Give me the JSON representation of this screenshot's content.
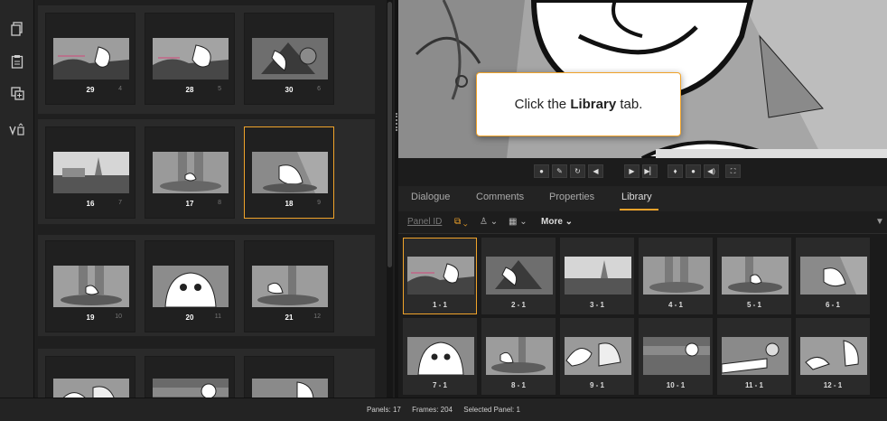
{
  "toolbar": {
    "icons": [
      "copy-icon",
      "paste-icon",
      "duplicate-icon",
      "version-icon"
    ]
  },
  "board": {
    "scenes": [
      {
        "panels": [
          {
            "number": "29",
            "index": "4"
          },
          {
            "number": "28",
            "index": "5"
          },
          {
            "number": "30",
            "index": "6"
          }
        ]
      },
      {
        "panels": [
          {
            "number": "16",
            "index": "7"
          },
          {
            "number": "17",
            "index": "8"
          },
          {
            "number": "18",
            "index": "9"
          }
        ]
      },
      {
        "panels": [
          {
            "number": "19",
            "index": "10"
          },
          {
            "number": "20",
            "index": "11"
          },
          {
            "number": "21",
            "index": "12"
          }
        ]
      },
      {
        "panels": [
          {
            "number": "",
            "index": ""
          },
          {
            "number": "",
            "index": ""
          },
          {
            "number": "",
            "index": ""
          }
        ]
      }
    ]
  },
  "tabs": [
    "Dialogue",
    "Comments",
    "Properties",
    "Library"
  ],
  "active_tab": "Library",
  "filters": {
    "panel_id_placeholder": "Panel ID",
    "more_label": "More"
  },
  "library": {
    "panels": [
      "1 - 1",
      "2 - 1",
      "3 - 1",
      "4 - 1",
      "5 - 1",
      "6 - 1",
      "7 - 1",
      "8 - 1",
      "9 - 1",
      "10 - 1",
      "11 - 1",
      "12 - 1"
    ]
  },
  "callout": {
    "text_prefix": "Click the ",
    "text_bold": "Library",
    "text_suffix": " tab."
  },
  "status": {
    "panels": "Panels: 17",
    "frames": "Frames: 204",
    "selected": "Selected Panel: 1"
  },
  "colors": {
    "accent": "#f0a32a",
    "background": "#1b1b1b"
  }
}
